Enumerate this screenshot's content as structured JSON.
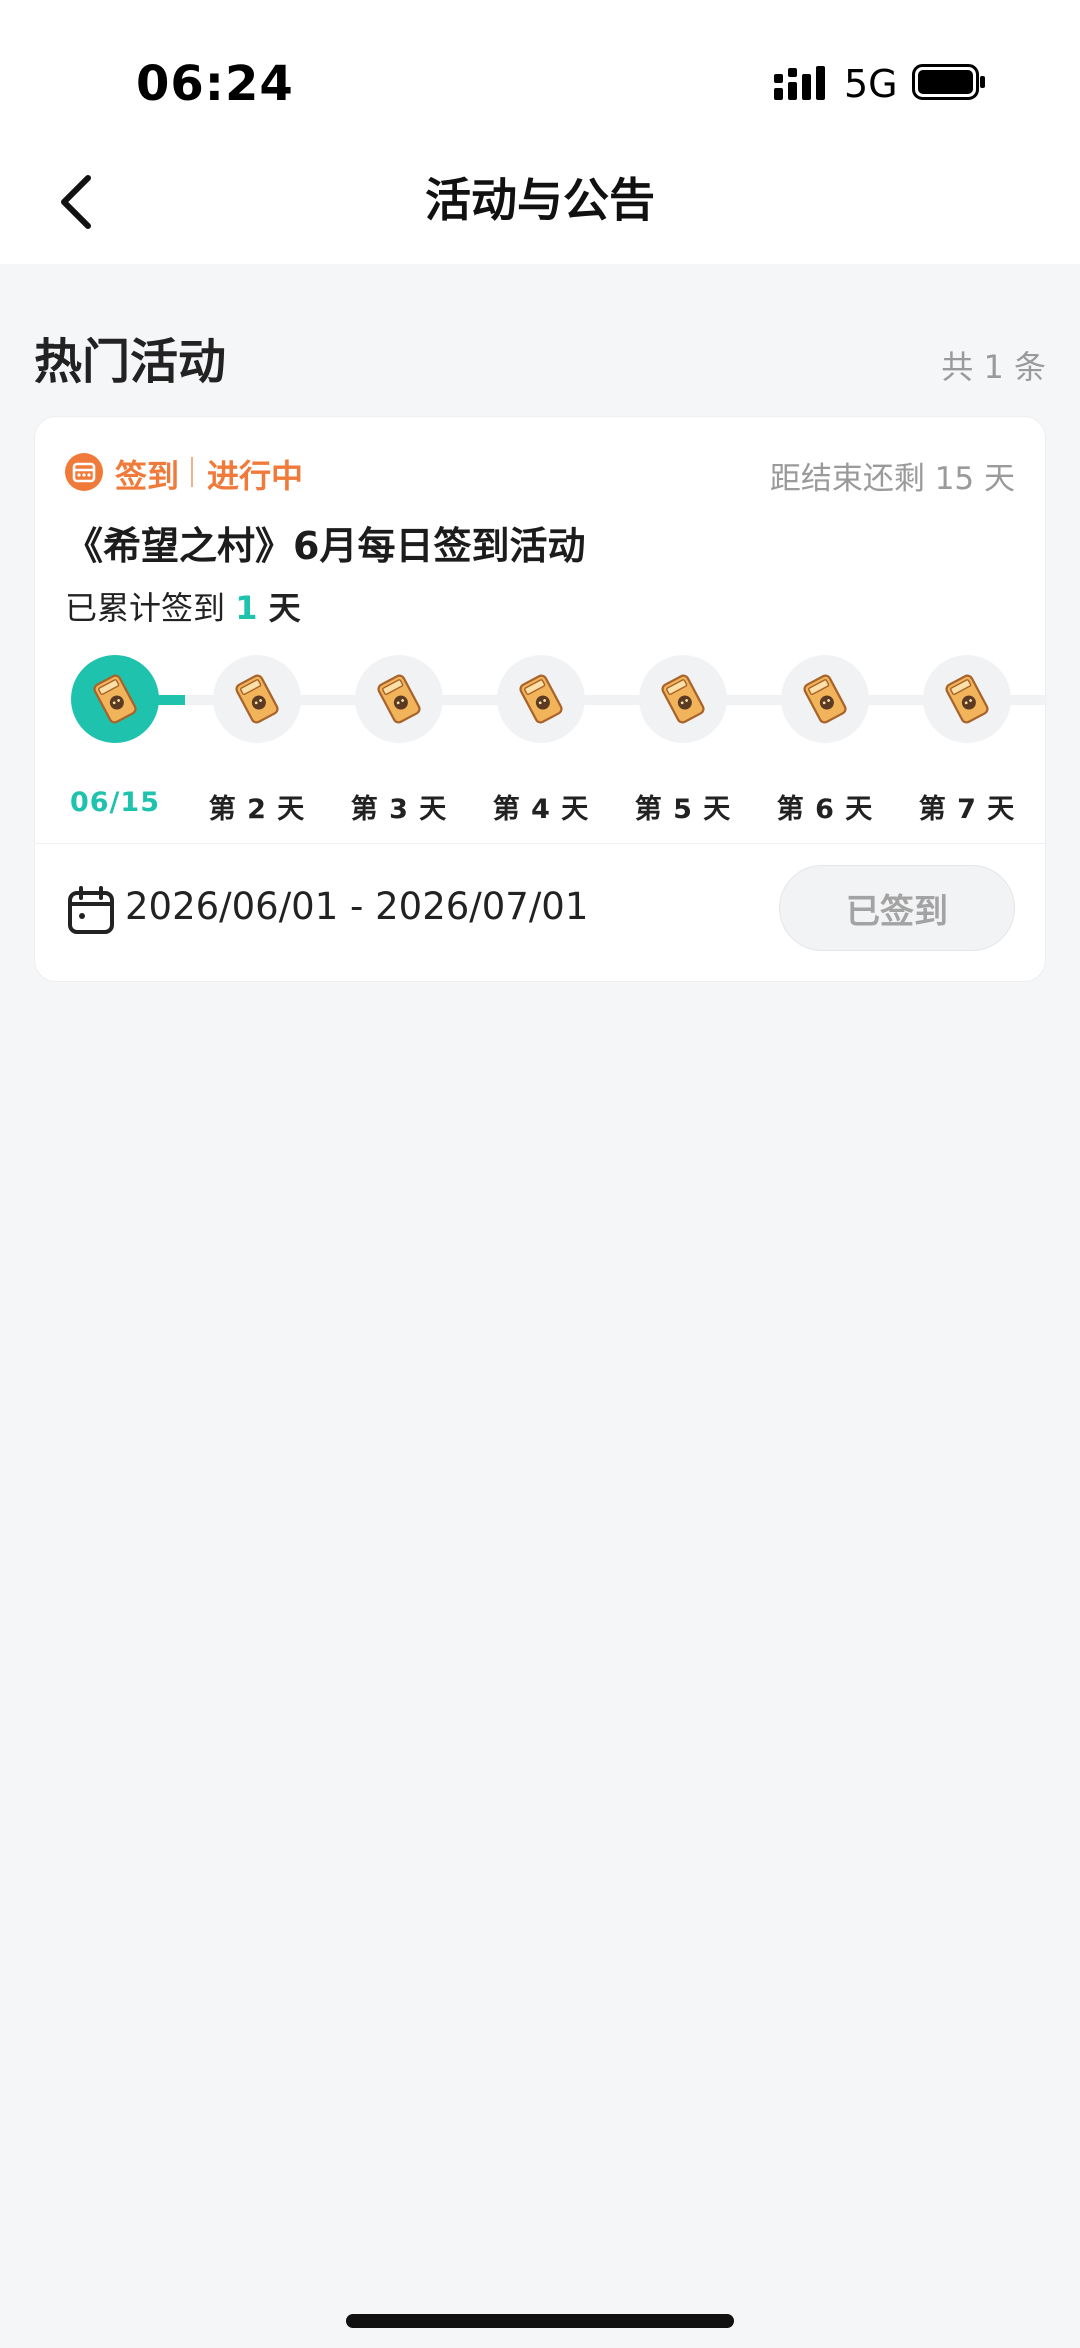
{
  "status_bar": {
    "time": "06:24",
    "network": "5G"
  },
  "nav": {
    "title": "活动与公告"
  },
  "section": {
    "title": "热门活动",
    "count": "共 1 条"
  },
  "activity": {
    "type": "签到",
    "status": "进行中",
    "remaining": "距结束还剩 15 天",
    "title": "《希望之村》6月每日签到活动",
    "cumulative_prefix": "已累计签到 ",
    "cumulative_days": "1",
    "cumulative_unit": " 天",
    "days": [
      {
        "label": "06/15",
        "active": true
      },
      {
        "label": "第 2 天",
        "active": false
      },
      {
        "label": "第 3 天",
        "active": false
      },
      {
        "label": "第 4 天",
        "active": false
      },
      {
        "label": "第 5 天",
        "active": false
      },
      {
        "label": "第 6 天",
        "active": false
      },
      {
        "label": "第 7 天",
        "active": false
      }
    ],
    "date_range": "2026/06/01 - 2026/07/01",
    "button_label": "已签到"
  },
  "colors": {
    "accent": "#1fc2ad",
    "tag": "#f07a3a",
    "reward": "#f2b45a"
  },
  "icons": {
    "back": "chevron-left-icon",
    "tag": "calendar-badge-icon",
    "reward": "ticket-reward-icon",
    "date": "calendar-icon"
  }
}
